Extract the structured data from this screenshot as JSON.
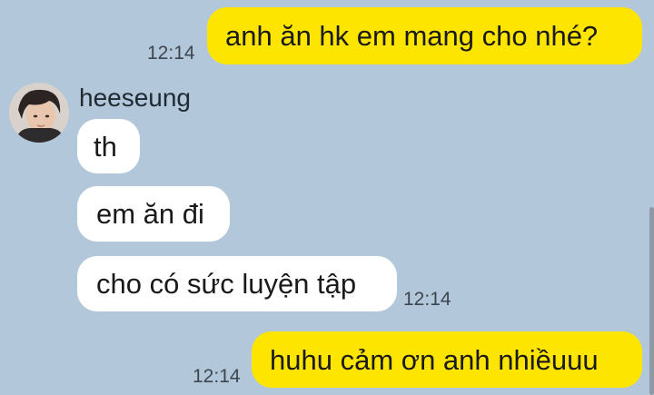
{
  "conversation": {
    "messages": [
      {
        "sender": "me",
        "text": "anh ăn hk em mang cho nhé?",
        "time": "12:14"
      },
      {
        "sender": "heeseung",
        "text": "th"
      },
      {
        "sender": "heeseung",
        "text": "em ăn đi"
      },
      {
        "sender": "heeseung",
        "text": "cho có sức luyện tập",
        "time": "12:14"
      },
      {
        "sender": "me",
        "text": "huhu cảm ơn anh nhiềuuu",
        "time": "12:14"
      }
    ],
    "contact": {
      "name": "heeseung",
      "avatar": "profile-photo"
    }
  },
  "colors": {
    "background": "#b2c7d9",
    "outgoing_bubble": "#fee500",
    "incoming_bubble": "#ffffff"
  }
}
